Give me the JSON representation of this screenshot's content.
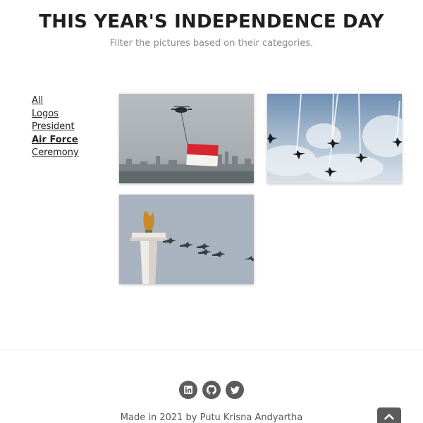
{
  "header": {
    "title": "THIS YEAR'S INDEPENDENCE DAY",
    "subtitle": "Filter the pictures based on their categories."
  },
  "filters": [
    {
      "label": "All",
      "active": false
    },
    {
      "label": "Logos",
      "active": false
    },
    {
      "label": "President",
      "active": false
    },
    {
      "label": "Air Force",
      "active": true
    },
    {
      "label": "Ceremony",
      "active": false
    }
  ],
  "gallery": {
    "photos": [
      {
        "subject": "helicopter carrying red and white flag over city"
      },
      {
        "subject": "jet formation with smoke trails in cloudy sky"
      },
      {
        "subject": "jets flying past national monument"
      }
    ]
  },
  "footer": {
    "social_icons": [
      "linkedin-icon",
      "github-icon",
      "twitter-icon"
    ],
    "credit": "Made in 2021 by Putu Krisna Andyartha"
  },
  "colors": {
    "icon_bg": "#5b5b5b",
    "flag_red": "#d7262e",
    "divider": "#e2e2e2"
  }
}
